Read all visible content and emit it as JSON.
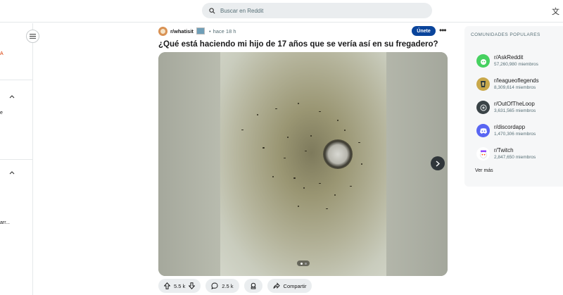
{
  "search": {
    "placeholder": "Buscar en Reddit"
  },
  "header": {
    "translate_icon": "translate-icon"
  },
  "left_nav": {
    "fragments": [
      "A",
      "e",
      "arr..."
    ]
  },
  "post": {
    "subreddit": "r/whatisit",
    "separator": "•",
    "time": "hace 18 h",
    "join_label": "Únete",
    "title": "¿Qué está haciendo mi hijo de 17 años que se vería así en su fregadero?",
    "upvotes": "5.5 k",
    "comments": "2.5 k",
    "share_label": "Compartir",
    "carousel": {
      "current_page": 1,
      "total_pages": 2
    }
  },
  "sidebar": {
    "heading": "COMUNIDADES POPULARES",
    "communities": [
      {
        "name": "r/AskReddit",
        "members": "57,260,980 miembros",
        "color": "#46d160",
        "icon": "askreddit-icon"
      },
      {
        "name": "r/leagueoflegends",
        "members": "8,309,614 miembros",
        "color": "#c9a84a",
        "icon": "league-icon"
      },
      {
        "name": "r/OutOfTheLoop",
        "members": "3,631,565 miembros",
        "color": "#3a4347",
        "icon": "loop-icon"
      },
      {
        "name": "r/discordapp",
        "members": "1,470,306 miembros",
        "color": "#5865f2",
        "icon": "discord-icon"
      },
      {
        "name": "r/Twitch",
        "members": "2,847,650 miembros",
        "color": "#ffffff",
        "icon": "twitch-icon"
      }
    ],
    "see_more": "Ver más"
  },
  "colors": {
    "join_button": "#0a449b",
    "search_bg": "#eaedef",
    "action_bg": "#eaedef",
    "sidebar_bg": "#f6f7f8"
  }
}
